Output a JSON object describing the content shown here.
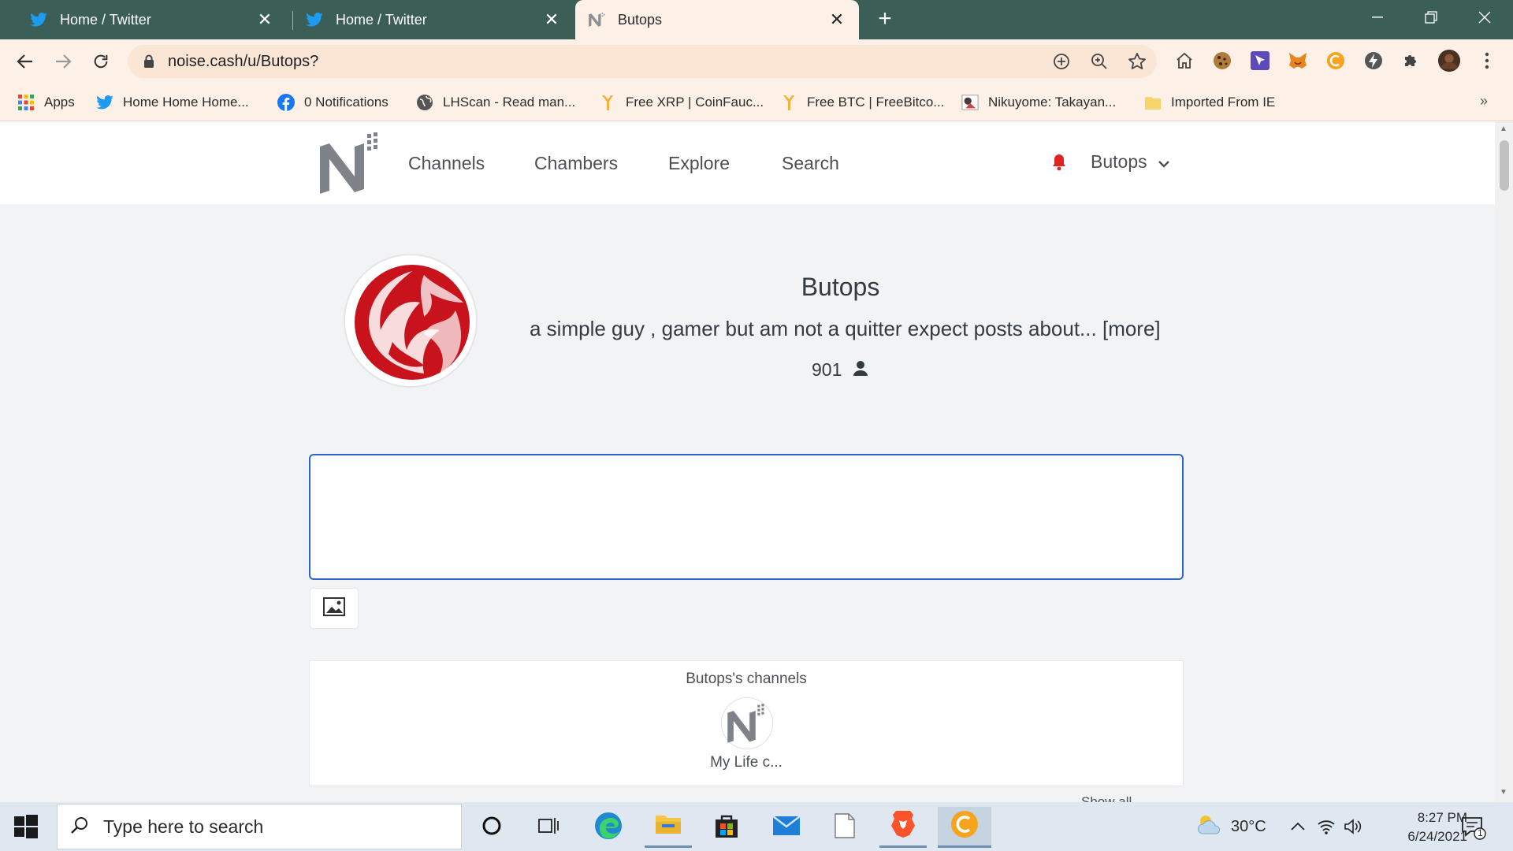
{
  "browser": {
    "tabs": [
      {
        "title": "Home / Twitter",
        "active": false
      },
      {
        "title": "Home / Twitter",
        "active": false
      },
      {
        "title": "Butops",
        "active": true
      }
    ],
    "url": "noise.cash/u/Butops?",
    "bookmarks": [
      {
        "label": "Apps",
        "icon": "apps-grid-icon"
      },
      {
        "label": "Home Home Home...",
        "icon": "twitter-bird-icon"
      },
      {
        "label": "0 Notifications",
        "icon": "facebook-icon"
      },
      {
        "label": "LHScan - Read man...",
        "icon": "globe-icon"
      },
      {
        "label": "Free XRP | CoinFauc...",
        "icon": "faucet-icon"
      },
      {
        "label": "Free BTC | FreeBitco...",
        "icon": "faucet-icon"
      },
      {
        "label": "Nikuyome: Takayan...",
        "icon": "manga-icon"
      },
      {
        "label": "Imported From IE",
        "icon": "folder-icon"
      }
    ],
    "bookmarks_overflow": "»"
  },
  "site": {
    "nav": [
      "Channels",
      "Chambers",
      "Explore",
      "Search"
    ],
    "user_menu_label": "Butops",
    "colors": {
      "accent_blue": "#2f63c7",
      "bell_red": "#e02424"
    }
  },
  "profile": {
    "name": "Butops",
    "bio": "a simple guy , gamer but am not a quitter expect posts about...",
    "bio_more": "[more]",
    "followers": "901"
  },
  "channels": {
    "title": "Butops's channels",
    "items": [
      {
        "name": "My Life c..."
      }
    ],
    "show_all": "Show all"
  },
  "taskbar": {
    "search_placeholder": "Type here to search",
    "weather": "30°C",
    "time": "8:27 PM",
    "date": "6/24/2021",
    "notification_count": "1"
  }
}
